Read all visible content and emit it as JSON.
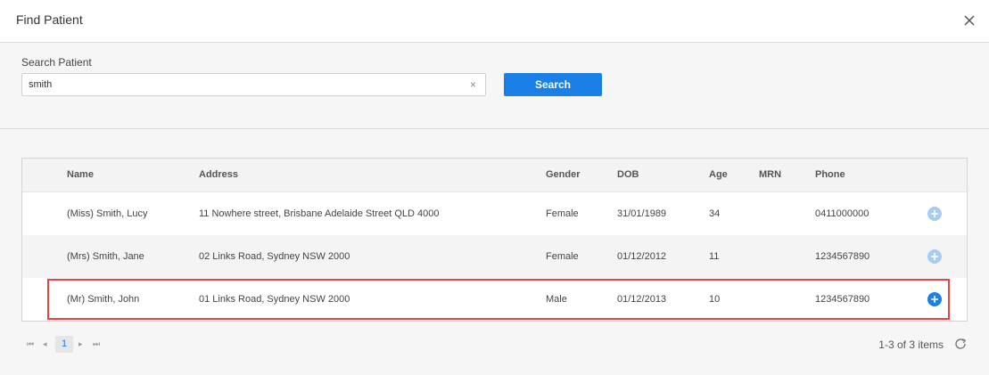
{
  "dialog": {
    "title": "Find Patient",
    "close_icon": "close-icon"
  },
  "search": {
    "label": "Search Patient",
    "value": "smith",
    "clear_glyph": "×",
    "button_label": "Search"
  },
  "table": {
    "columns": {
      "name": "Name",
      "address": "Address",
      "gender": "Gender",
      "dob": "DOB",
      "age": "Age",
      "mrn": "MRN",
      "phone": "Phone"
    },
    "rows": [
      {
        "name": "(Miss) Smith, Lucy",
        "address": "11 Nowhere street, Brisbane Adelaide Street QLD 4000",
        "gender": "Female",
        "dob": "31/01/1989",
        "age": "34",
        "mrn": "",
        "phone": "0411000000",
        "selected": false
      },
      {
        "name": "(Mrs) Smith, Jane",
        "address": "02 Links Road, Sydney NSW 2000",
        "gender": "Female",
        "dob": "01/12/2012",
        "age": "11",
        "mrn": "",
        "phone": "1234567890",
        "selected": false
      },
      {
        "name": "(Mr) Smith, John",
        "address": "01 Links Road, Sydney NSW 2000",
        "gender": "Male",
        "dob": "01/12/2013",
        "age": "10",
        "mrn": "",
        "phone": "1234567890",
        "selected": true
      }
    ]
  },
  "pager": {
    "first_glyph": "⏮",
    "prev_glyph": "◂",
    "current_page": "1",
    "next_glyph": "▸",
    "last_glyph": "⏭",
    "items_text": "1-3 of 3 items"
  },
  "colors": {
    "accent": "#1a7fe6",
    "add_inactive": "#a8cdf5",
    "highlight": "#e04848"
  }
}
